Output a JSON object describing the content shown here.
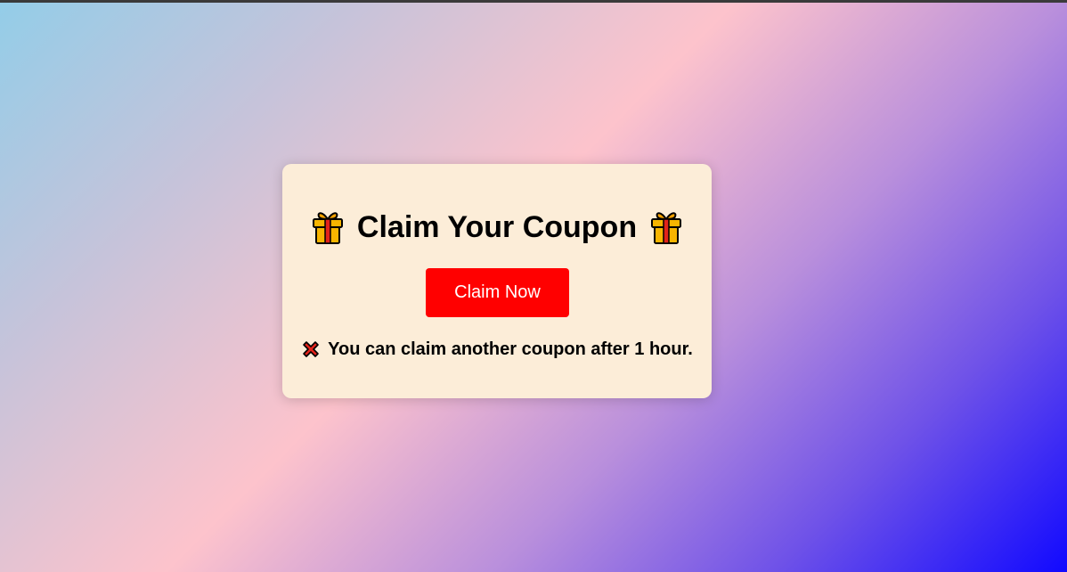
{
  "card": {
    "title": "Claim Your Coupon",
    "title_icon": "gift-icon",
    "button_label": "Claim Now",
    "message": "You can claim another coupon after 1 hour.",
    "message_icon": "cross-mark-icon"
  },
  "colors": {
    "button": "#ff0000",
    "card_background": "#fcedd8",
    "gradient_start": "#93cde8",
    "gradient_mid": "#fdc3cc",
    "gradient_end": "#1109ff"
  }
}
